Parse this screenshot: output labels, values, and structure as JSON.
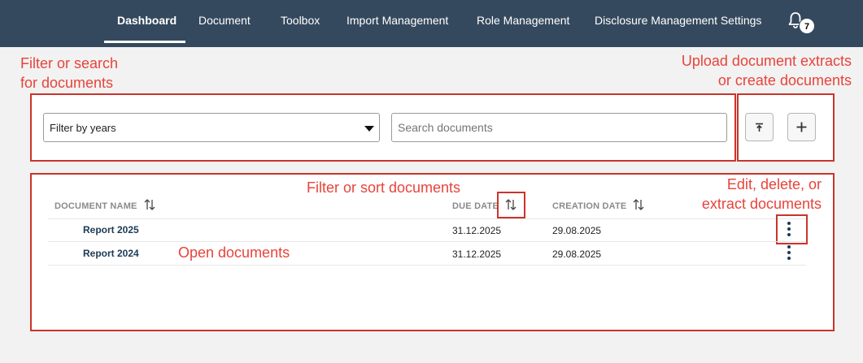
{
  "nav": {
    "items": [
      {
        "label": "Dashboard",
        "active": true
      },
      {
        "label": "Document"
      },
      {
        "label": "Toolbox"
      },
      {
        "label": "Import Management"
      },
      {
        "label": "Role Management"
      },
      {
        "label": "Disclosure Management Settings"
      }
    ],
    "notifications_count": "7",
    "notification_icon": "bell-icon"
  },
  "annotations": {
    "filter_search": "Filter or search\nfor documents",
    "upload_create": "Upload document extracts\nor create documents",
    "filter_sort": "Filter or sort documents",
    "edit_delete": "Edit, delete, or\nextract documents",
    "open_docs": "Open documents",
    "color": "#e8433a"
  },
  "filters": {
    "year_select_value": "Filter by years",
    "search_placeholder": "Search documents"
  },
  "actions": {
    "upload_icon": "upload-icon",
    "add_icon": "plus-icon"
  },
  "table": {
    "columns": [
      {
        "label": "DOCUMENT NAME",
        "sortable": true
      },
      {
        "label": "DUE DATE",
        "sortable": true
      },
      {
        "label": "CREATION DATE",
        "sortable": true
      }
    ],
    "rows": [
      {
        "name": "Report 2025",
        "due_date": "31.12.2025",
        "creation_date": "29.08.2025"
      },
      {
        "name": "Report 2024",
        "due_date": "31.12.2025",
        "creation_date": "29.08.2025"
      }
    ]
  },
  "theme": {
    "nav_bg": "#35495e",
    "page_bg": "#f2f2f2",
    "annotation_box": "#c9352b"
  }
}
